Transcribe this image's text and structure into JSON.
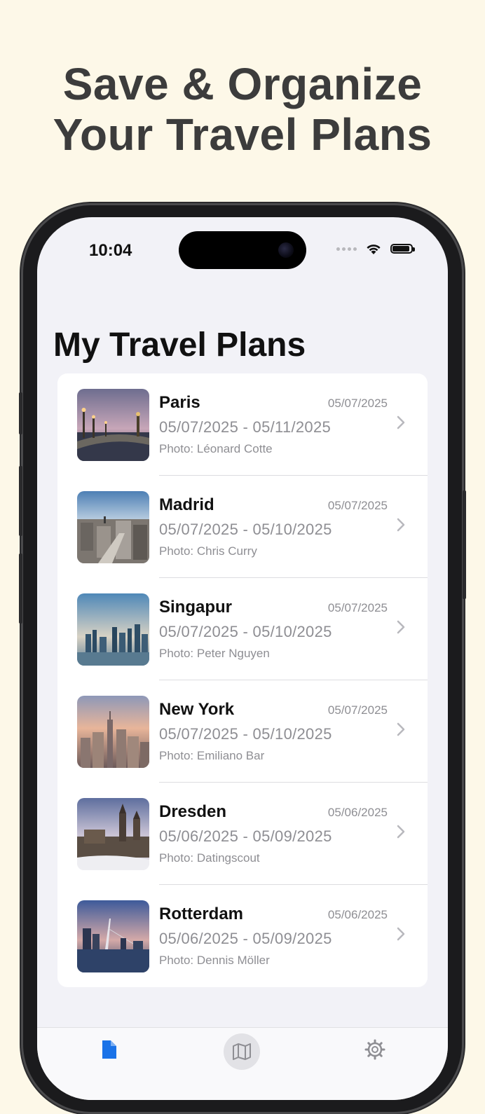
{
  "headline": {
    "line1": "Save & Organize",
    "line2": "Your Travel Plans"
  },
  "status": {
    "time": "10:04"
  },
  "title": "My Travel Plans",
  "trips": [
    {
      "city": "Paris",
      "date": "05/07/2025",
      "range": "05/07/2025 - 05/11/2025",
      "credit": "Photo: Léonard Cotte"
    },
    {
      "city": "Madrid",
      "date": "05/07/2025",
      "range": "05/07/2025 - 05/10/2025",
      "credit": "Photo: Chris Curry"
    },
    {
      "city": "Singapur",
      "date": "05/07/2025",
      "range": "05/07/2025 - 05/10/2025",
      "credit": "Photo: Peter Nguyen"
    },
    {
      "city": "New York",
      "date": "05/07/2025",
      "range": "05/07/2025 - 05/10/2025",
      "credit": "Photo: Emiliano Bar"
    },
    {
      "city": "Dresden",
      "date": "05/06/2025",
      "range": "05/06/2025 - 05/09/2025",
      "credit": "Photo: Datingscout"
    },
    {
      "city": "Rotterdam",
      "date": "05/06/2025",
      "range": "05/06/2025 - 05/09/2025",
      "credit": "Photo: Dennis Möller"
    }
  ],
  "tabs": [
    {
      "icon": "document-icon",
      "active": true
    },
    {
      "icon": "map-icon",
      "active": false
    },
    {
      "icon": "gear-icon",
      "active": false
    }
  ],
  "colors": {
    "background": "#fdf8e8",
    "accent": "#1a73e8",
    "headline": "#3c3c3c"
  }
}
